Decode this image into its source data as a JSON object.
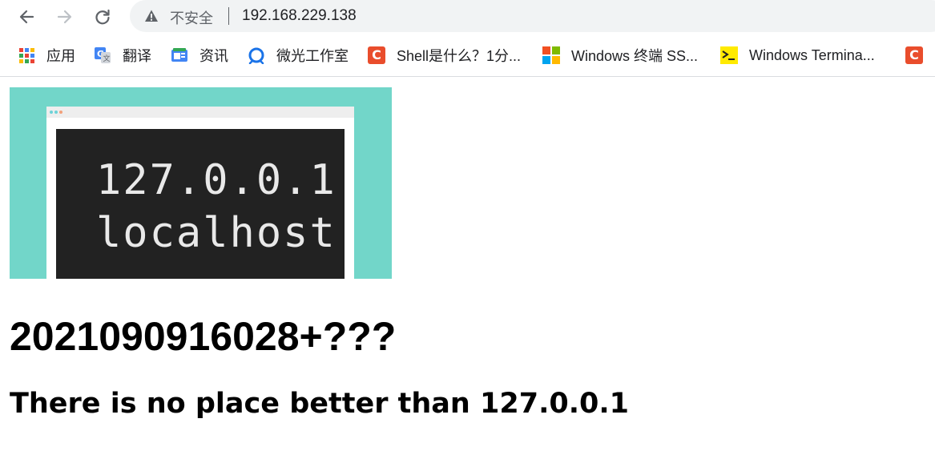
{
  "browser": {
    "security_label": "不安全",
    "url": "192.168.229.138",
    "icons": [
      "back-arrow-icon",
      "forward-arrow-icon",
      "reload-icon",
      "warning-icon"
    ]
  },
  "bookmarks": [
    {
      "label": "应用",
      "icon": "apps-grid-icon"
    },
    {
      "label": "翻译",
      "icon": "google-translate-icon"
    },
    {
      "label": "资讯",
      "icon": "news-icon"
    },
    {
      "label": "微光工作室",
      "icon": "weiguang-icon"
    },
    {
      "label": "Shell是什么？1分...",
      "icon": "csdn-icon"
    },
    {
      "label": "Windows 终端 SS...",
      "icon": "microsoft-icon"
    },
    {
      "label": "Windows Termina...",
      "icon": "terminal-icon"
    },
    {
      "label": "",
      "icon": "csdn-icon"
    }
  ],
  "colors": {
    "hero_bg": "#72d6c9",
    "screen_bg": "#222222",
    "csdn_red": "#e94d2c",
    "terminal_yellow": "#ffea00"
  },
  "page": {
    "hero_lines": [
      "127.0.0.1",
      "localhost"
    ],
    "heading": "2021090916028+???",
    "subheading": "There is no place better than 127.0.0.1"
  }
}
